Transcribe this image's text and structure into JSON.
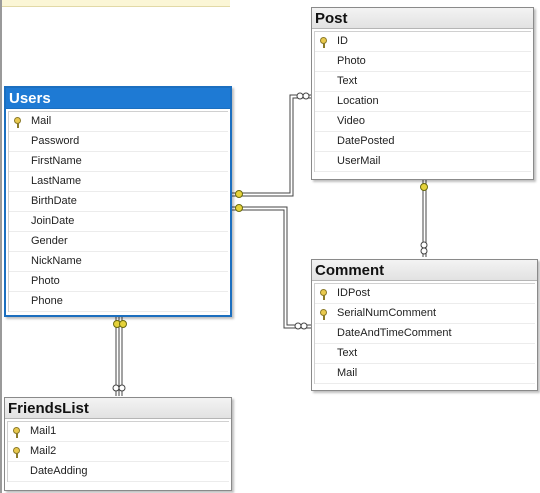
{
  "tables": {
    "users": {
      "title": "Users",
      "columns": [
        {
          "name": "Mail",
          "key": true
        },
        {
          "name": "Password",
          "key": false
        },
        {
          "name": "FirstName",
          "key": false
        },
        {
          "name": "LastName",
          "key": false
        },
        {
          "name": "BirthDate",
          "key": false
        },
        {
          "name": "JoinDate",
          "key": false
        },
        {
          "name": "Gender",
          "key": false
        },
        {
          "name": "NickName",
          "key": false
        },
        {
          "name": "Photo",
          "key": false
        },
        {
          "name": "Phone",
          "key": false
        }
      ]
    },
    "post": {
      "title": "Post",
      "columns": [
        {
          "name": "ID",
          "key": true
        },
        {
          "name": "Photo",
          "key": false
        },
        {
          "name": "Text",
          "key": false
        },
        {
          "name": "Location",
          "key": false
        },
        {
          "name": "Video",
          "key": false
        },
        {
          "name": "DatePosted",
          "key": false
        },
        {
          "name": "UserMail",
          "key": false
        }
      ]
    },
    "comment": {
      "title": "Comment",
      "columns": [
        {
          "name": "IDPost",
          "key": true
        },
        {
          "name": "SerialNumComment",
          "key": true
        },
        {
          "name": "DateAndTimeComment",
          "key": false
        },
        {
          "name": "Text",
          "key": false
        },
        {
          "name": "Mail",
          "key": false
        }
      ]
    },
    "friendslist": {
      "title": "FriendsList",
      "columns": [
        {
          "name": "Mail1",
          "key": true
        },
        {
          "name": "Mail2",
          "key": true
        },
        {
          "name": "DateAdding",
          "key": false
        }
      ]
    }
  },
  "relationships": [
    {
      "from": "Users",
      "to": "Post"
    },
    {
      "from": "Users",
      "to": "Comment"
    },
    {
      "from": "Post",
      "to": "Comment"
    },
    {
      "from": "Users",
      "to": "FriendsList"
    }
  ]
}
